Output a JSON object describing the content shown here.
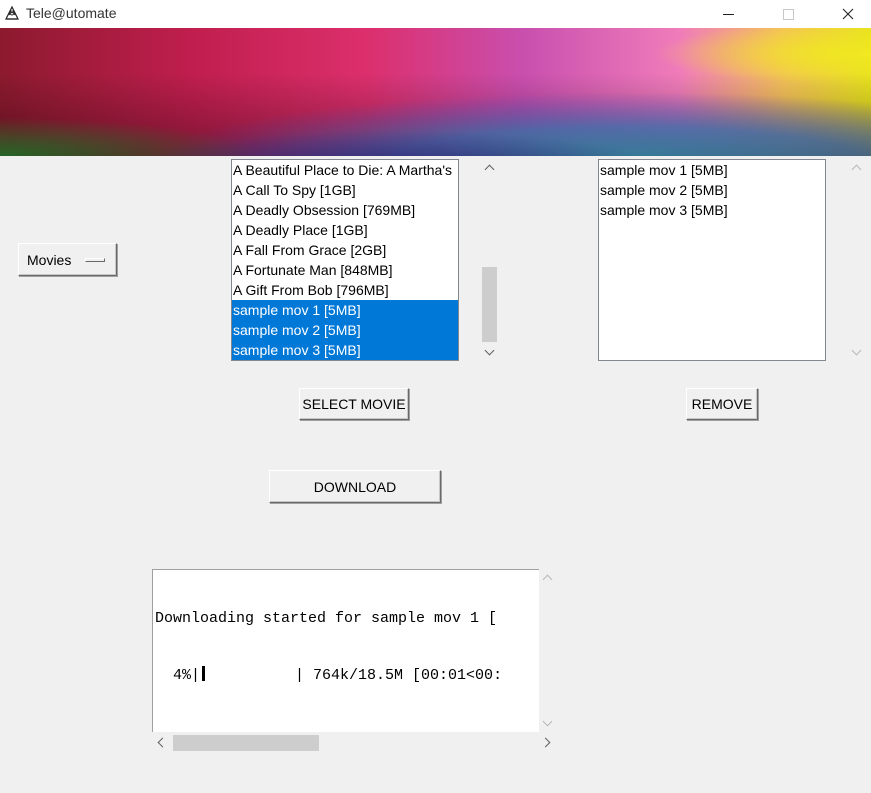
{
  "window": {
    "title": "Tele@utomate",
    "icon": "tk-feather-icon",
    "controls": [
      "minimize-icon",
      "maximize-icon",
      "close-icon"
    ]
  },
  "banner": {
    "colors": [
      "#9a1a30",
      "#c8245a",
      "#e0306e",
      "#c84fb0",
      "#6a5cd6",
      "#5aa6e6",
      "#57c3e8",
      "#f0d050",
      "#e8e020",
      "#3fa050"
    ]
  },
  "category_menu": {
    "selected": "Movies"
  },
  "movie_list": {
    "items": [
      {
        "label": "A Beautiful Place to Die: A Martha's",
        "selected": false
      },
      {
        "label": "A Call To Spy [1GB]",
        "selected": false
      },
      {
        "label": "A Deadly Obsession [769MB]",
        "selected": false
      },
      {
        "label": "A Deadly Place [1GB]",
        "selected": false
      },
      {
        "label": "A Fall From Grace [2GB]",
        "selected": false
      },
      {
        "label": "A Fortunate Man [848MB]",
        "selected": false
      },
      {
        "label": "A Gift From Bob [796MB]",
        "selected": false
      },
      {
        "label": "sample mov 1 [5MB]",
        "selected": true
      },
      {
        "label": "sample mov 2 [5MB]",
        "selected": true
      },
      {
        "label": "sample mov 3 [5MB]",
        "selected": true
      }
    ],
    "selection_color": "#0078d7"
  },
  "selected_list": {
    "items": [
      "sample mov 1 [5MB]",
      "sample mov 2 [5MB]",
      "sample mov 3 [5MB]"
    ]
  },
  "buttons": {
    "select": "SELECT MOVIE",
    "remove": "REMOVE",
    "download": "DOWNLOAD"
  },
  "log": {
    "line1": "Downloading started for sample mov 1 [",
    "line2_prefix": "  4%|",
    "line2_suffix": "          | 764k/18.5M [00:01<00:",
    "progress_percent": 4
  }
}
